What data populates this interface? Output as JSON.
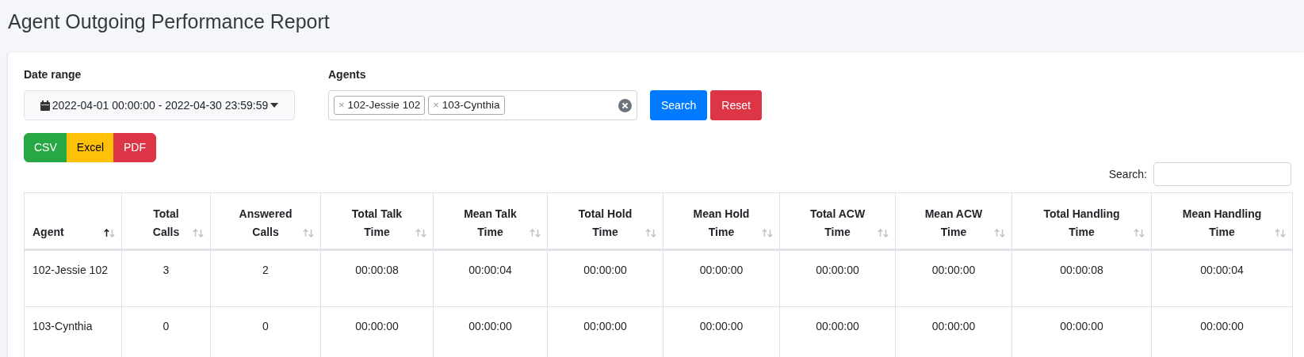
{
  "page_title": "Agent Outgoing Performance Report",
  "filters": {
    "date_range": {
      "label": "Date range",
      "value": "2022-04-01 00:00:00 - 2022-04-30 23:59:59"
    },
    "agents": {
      "label": "Agents",
      "tag_remove": "×",
      "tags": [
        {
          "label": "102-Jessie 102"
        },
        {
          "label": "103-Cynthia"
        }
      ]
    },
    "buttons": [
      {
        "label": "Search",
        "kind": "primary"
      },
      {
        "label": "Reset",
        "kind": "danger"
      }
    ]
  },
  "export_buttons": [
    {
      "label": "CSV",
      "kind": "success"
    },
    {
      "label": "Excel",
      "kind": "warning"
    },
    {
      "label": "PDF",
      "kind": "danger"
    }
  ],
  "table_search": {
    "label": "Search:"
  },
  "table": {
    "columns": [
      {
        "label": "Agent",
        "sorted_ascending": true
      },
      {
        "label": "Total Calls",
        "sorted_ascending": false
      },
      {
        "label": "Answered Calls",
        "sorted_ascending": false
      },
      {
        "label": "Total Talk Time",
        "sorted_ascending": false
      },
      {
        "label": "Mean Talk Time",
        "sorted_ascending": false
      },
      {
        "label": "Total Hold Time",
        "sorted_ascending": false
      },
      {
        "label": "Mean Hold Time",
        "sorted_ascending": false
      },
      {
        "label": "Total ACW Time",
        "sorted_ascending": false
      },
      {
        "label": "Mean ACW Time",
        "sorted_ascending": false
      },
      {
        "label": "Total Handling Time",
        "sorted_ascending": false
      },
      {
        "label": "Mean Handling Time",
        "sorted_ascending": false
      }
    ],
    "rows": [
      [
        "102-Jessie 102",
        "3",
        "2",
        "00:00:08",
        "00:00:04",
        "00:00:00",
        "00:00:00",
        "00:00:00",
        "00:00:00",
        "00:00:08",
        "00:00:04"
      ],
      [
        "103-Cynthia",
        "0",
        "0",
        "00:00:00",
        "00:00:00",
        "00:00:00",
        "00:00:00",
        "00:00:00",
        "00:00:00",
        "00:00:00",
        "00:00:00"
      ]
    ]
  }
}
